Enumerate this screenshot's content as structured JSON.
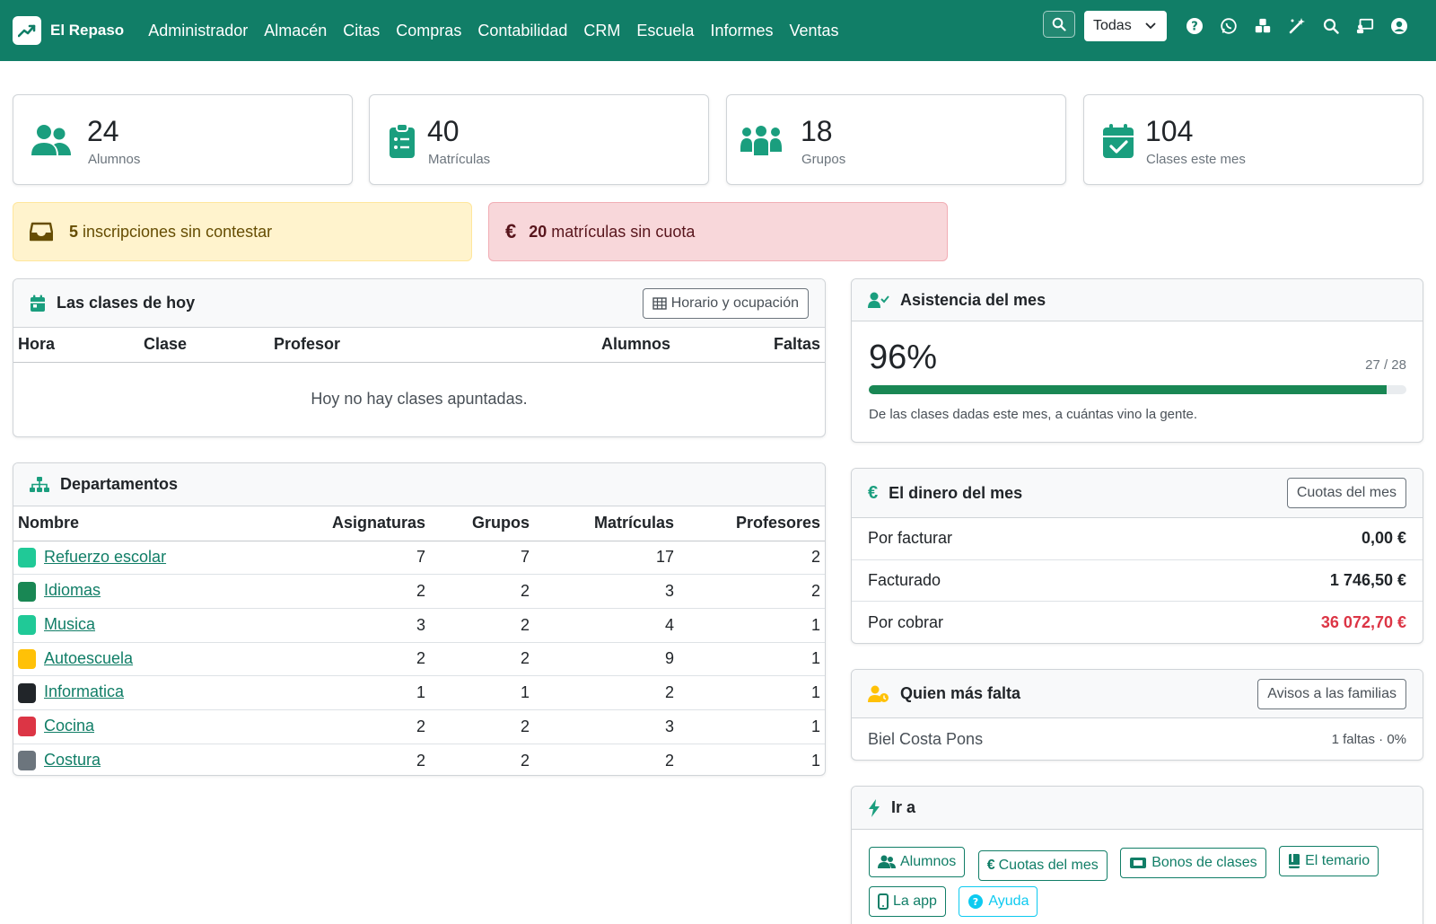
{
  "navbar": {
    "brand": "El Repaso",
    "links": [
      "Administrador",
      "Almacén",
      "Citas",
      "Compras",
      "Contabilidad",
      "CRM",
      "Escuela",
      "Informes",
      "Ventas"
    ],
    "scope_select": "Todas",
    "icons": [
      "search-icon",
      "help-icon",
      "whatsapp-icon",
      "boxes-icon",
      "magic-wand-icon",
      "search-icon",
      "presentation-icon",
      "user-circle-icon"
    ]
  },
  "stats": [
    {
      "value": "24",
      "label": "Alumnos",
      "icon": "users-icon"
    },
    {
      "value": "40",
      "label": "Matrículas",
      "icon": "clipboard-list-icon"
    },
    {
      "value": "18",
      "label": "Grupos",
      "icon": "group-icon"
    },
    {
      "value": "104",
      "label": "Clases este mes",
      "icon": "calendar-check-icon"
    }
  ],
  "alerts": {
    "inscripciones": {
      "count": "5",
      "text": "inscripciones sin contestar"
    },
    "matriculas": {
      "count": "20",
      "text": "matrículas sin cuota"
    }
  },
  "today": {
    "title": "Las clases de hoy",
    "button": "Horario y ocupación",
    "columns": [
      "Hora",
      "Clase",
      "Profesor",
      "Alumnos",
      "Faltas"
    ],
    "empty": "Hoy no hay clases apuntadas."
  },
  "departments": {
    "title": "Departamentos",
    "columns": [
      "Nombre",
      "Asignaturas",
      "Grupos",
      "Matrículas",
      "Profesores"
    ],
    "rows": [
      {
        "name": "Refuerzo escolar",
        "color": "#20c997",
        "asignaturas": "7",
        "grupos": "7",
        "matriculas": "17",
        "profesores": "2"
      },
      {
        "name": "Idiomas",
        "color": "#198754",
        "asignaturas": "2",
        "grupos": "2",
        "matriculas": "3",
        "profesores": "2"
      },
      {
        "name": "Musica",
        "color": "#20c997",
        "asignaturas": "3",
        "grupos": "2",
        "matriculas": "4",
        "profesores": "1"
      },
      {
        "name": "Autoescuela",
        "color": "#ffc107",
        "asignaturas": "2",
        "grupos": "2",
        "matriculas": "9",
        "profesores": "1"
      },
      {
        "name": "Informatica",
        "color": "#212529",
        "asignaturas": "1",
        "grupos": "1",
        "matriculas": "2",
        "profesores": "1"
      },
      {
        "name": "Cocina",
        "color": "#dc3545",
        "asignaturas": "2",
        "grupos": "2",
        "matriculas": "3",
        "profesores": "1"
      },
      {
        "name": "Costura",
        "color": "#6c757d",
        "asignaturas": "2",
        "grupos": "2",
        "matriculas": "2",
        "profesores": "1"
      }
    ]
  },
  "attendance": {
    "title": "Asistencia del mes",
    "percent": "96%",
    "ratio": "27 / 28",
    "progress": 0.964,
    "note": "De las clases dadas este mes, a cuántas vino la gente."
  },
  "money": {
    "title": "El dinero del mes",
    "button": "Cuotas del mes",
    "rows": [
      {
        "label": "Por facturar",
        "value": "0,00 €",
        "color": "#212529"
      },
      {
        "label": "Facturado",
        "value": "1 746,50 €",
        "color": "#212529"
      },
      {
        "label": "Por cobrar",
        "value": "36 072,70 €",
        "color": "#dc3545"
      }
    ]
  },
  "absences": {
    "title": "Quien más falta",
    "button": "Avisos a las familias",
    "rows": [
      {
        "name": "Biel Costa Pons",
        "detail": "1 faltas · 0%"
      }
    ]
  },
  "goto": {
    "title": "Ir a",
    "links": [
      "Alumnos",
      "Cuotas del mes",
      "Bonos de clases",
      "El temario",
      "La app",
      "Ayuda"
    ]
  },
  "colors": {
    "brand": "#117e67",
    "accent": "#1a9e7e",
    "danger": "#dc3545",
    "progress": "#198754"
  }
}
